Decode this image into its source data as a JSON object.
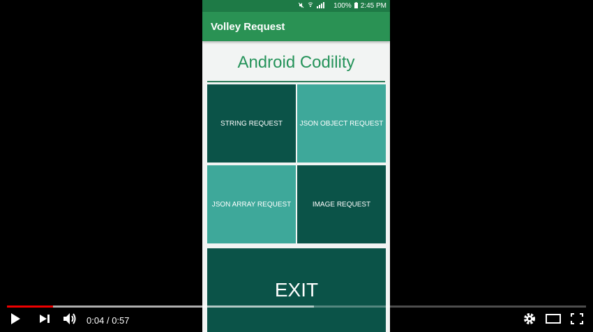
{
  "status_bar": {
    "battery": "100%",
    "time": "2:45 PM"
  },
  "app_bar": {
    "title": "Volley Request"
  },
  "main": {
    "header": "Android Codility",
    "tiles": [
      {
        "label": "STRING REQUEST"
      },
      {
        "label": "JSON OBJECT REQUEST"
      },
      {
        "label": "JSON ARRAY REQUEST"
      },
      {
        "label": "IMAGE REQUEST"
      }
    ],
    "exit_label": "EXIT"
  },
  "player": {
    "current_time": "0:04",
    "separator": "/",
    "duration": "0:57",
    "progress_played_fraction": 0.08,
    "progress_buffered_fraction": 0.53,
    "colors": {
      "played": "#e00000"
    },
    "icons": [
      "play-icon",
      "next-icon",
      "volume-icon",
      "settings-icon",
      "theater-mode-icon",
      "fullscreen-icon"
    ]
  },
  "colors": {
    "status_bar": "#1e7a46",
    "app_bar": "#2a9254",
    "title_green": "#25935a",
    "tile_dark": "#0b5348",
    "tile_light": "#3ea89a"
  }
}
